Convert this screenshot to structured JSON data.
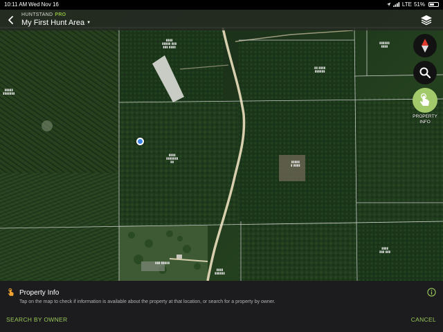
{
  "status_bar": {
    "time": "10:11 AM",
    "date": "Wed Nov 16",
    "network": "LTE",
    "battery": "51%",
    "battery_level": 0.51
  },
  "header": {
    "brand": "HUNTSTAND",
    "brand_tier": "PRO",
    "area_name": "My First Hunt Area",
    "back_icon": "chevron-left-icon",
    "layers_icon": "layers-icon"
  },
  "map_controls": {
    "compass_icon": "compass-icon",
    "search_icon": "search-icon",
    "property_icon": "tap-finger-icon",
    "property_label_line1": "PROPERTY",
    "property_label_line2": "INFO"
  },
  "map": {
    "basemap": "satellite",
    "accent_color": "#9bc85a",
    "parcel_line_color": "#e8e8e8",
    "road_color": "#d8cfae"
  },
  "panel": {
    "icon": "tap-finger-icon",
    "title": "Property Info",
    "description": "Tap on the map to check if information is available about the property at that location, or search for a property by owner.",
    "info_icon": "info-icon",
    "search_by_owner": "SEARCH BY OWNER",
    "cancel": "CANCEL"
  }
}
